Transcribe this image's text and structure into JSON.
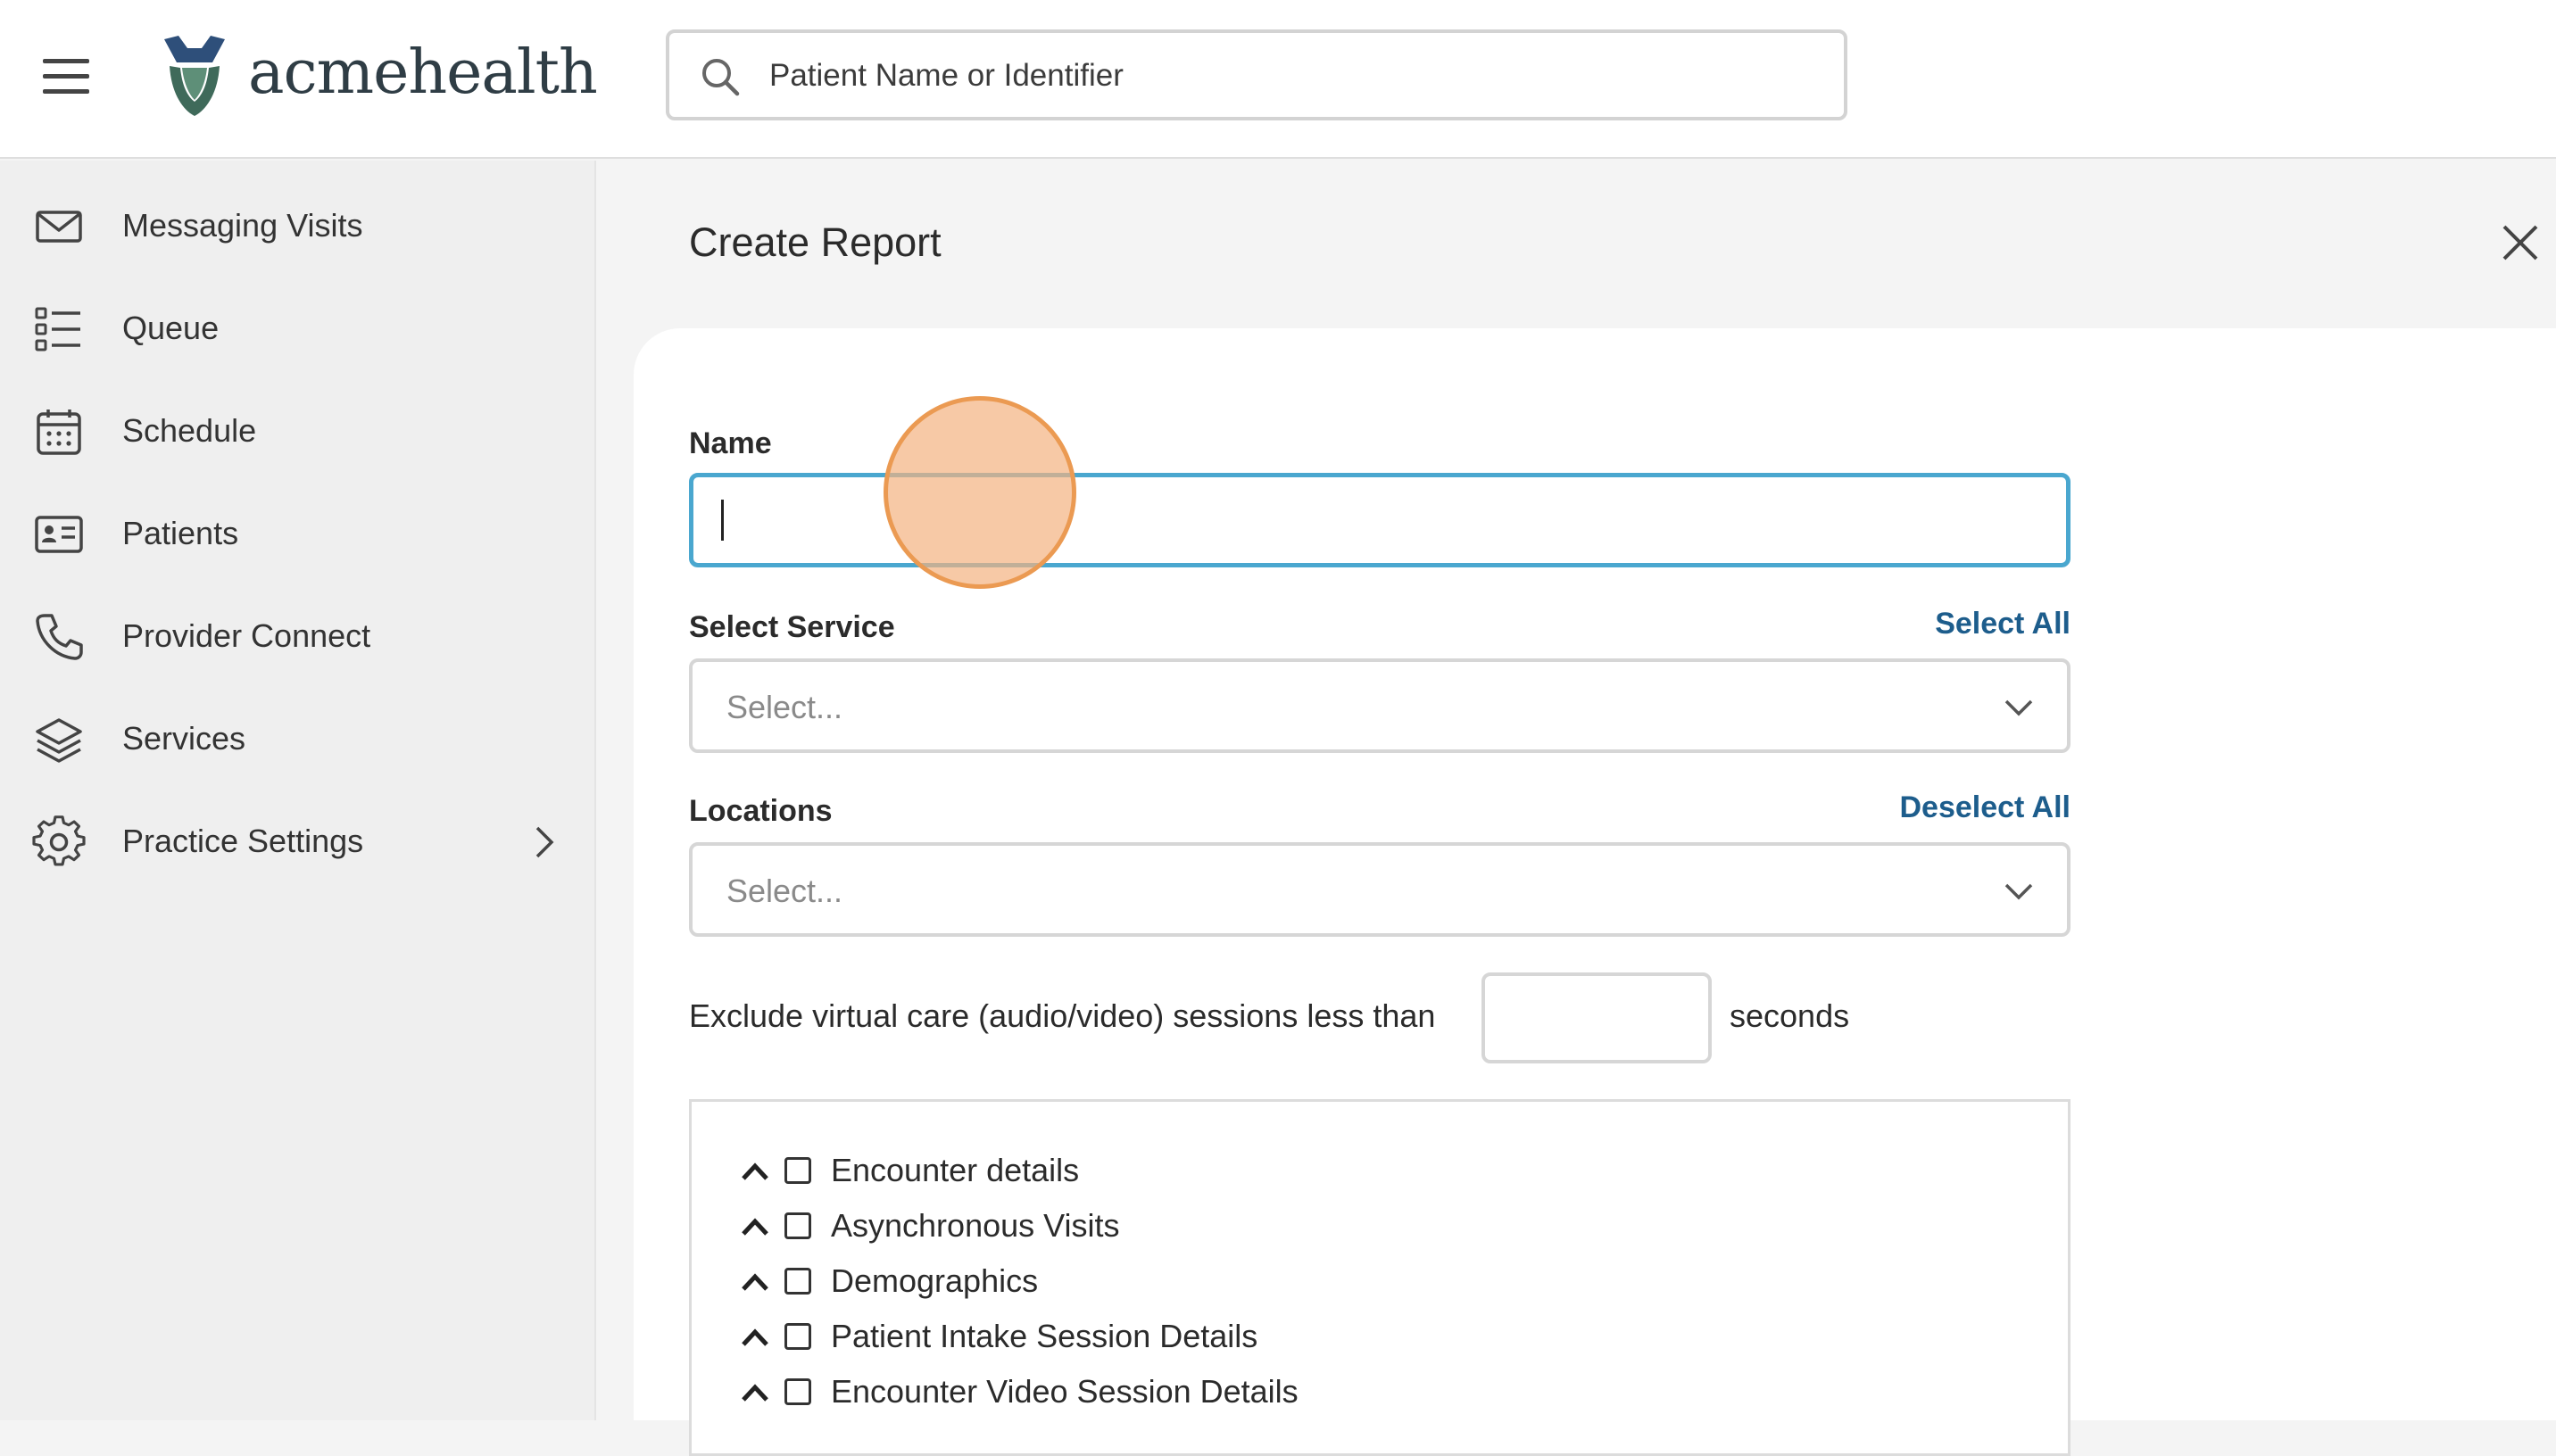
{
  "header": {
    "logo_text": "acmehealth",
    "search_placeholder": "Patient Name or Identifier"
  },
  "sidebar": {
    "items": [
      {
        "label": "Messaging Visits",
        "icon": "envelope-icon"
      },
      {
        "label": "Queue",
        "icon": "list-icon"
      },
      {
        "label": "Schedule",
        "icon": "calendar-icon"
      },
      {
        "label": "Patients",
        "icon": "id-card-icon"
      },
      {
        "label": "Provider Connect",
        "icon": "phone-icon"
      },
      {
        "label": "Services",
        "icon": "layers-icon"
      },
      {
        "label": "Practice Settings",
        "icon": "gear-icon",
        "has_submenu": true
      }
    ]
  },
  "main": {
    "title": "Create Report",
    "form": {
      "name_label": "Name",
      "name_value": "",
      "service_label": "Select Service",
      "service_action": "Select All",
      "service_placeholder": "Select...",
      "locations_label": "Locations",
      "locations_action": "Deselect All",
      "locations_placeholder": "Select...",
      "exclude_text": "Exclude virtual care (audio/video) sessions less than",
      "exclude_value": "",
      "seconds_text": "seconds"
    },
    "sections": [
      {
        "label": "Encounter details",
        "checked": false
      },
      {
        "label": "Asynchronous Visits",
        "checked": false
      },
      {
        "label": "Demographics",
        "checked": false
      },
      {
        "label": "Patient Intake Session Details",
        "checked": false
      },
      {
        "label": "Encounter Video Session Details",
        "checked": false
      }
    ]
  },
  "colors": {
    "accent_link": "#1d5d8c",
    "focus_border": "#4aa7cf",
    "click_indicator": "#eb9a52"
  }
}
